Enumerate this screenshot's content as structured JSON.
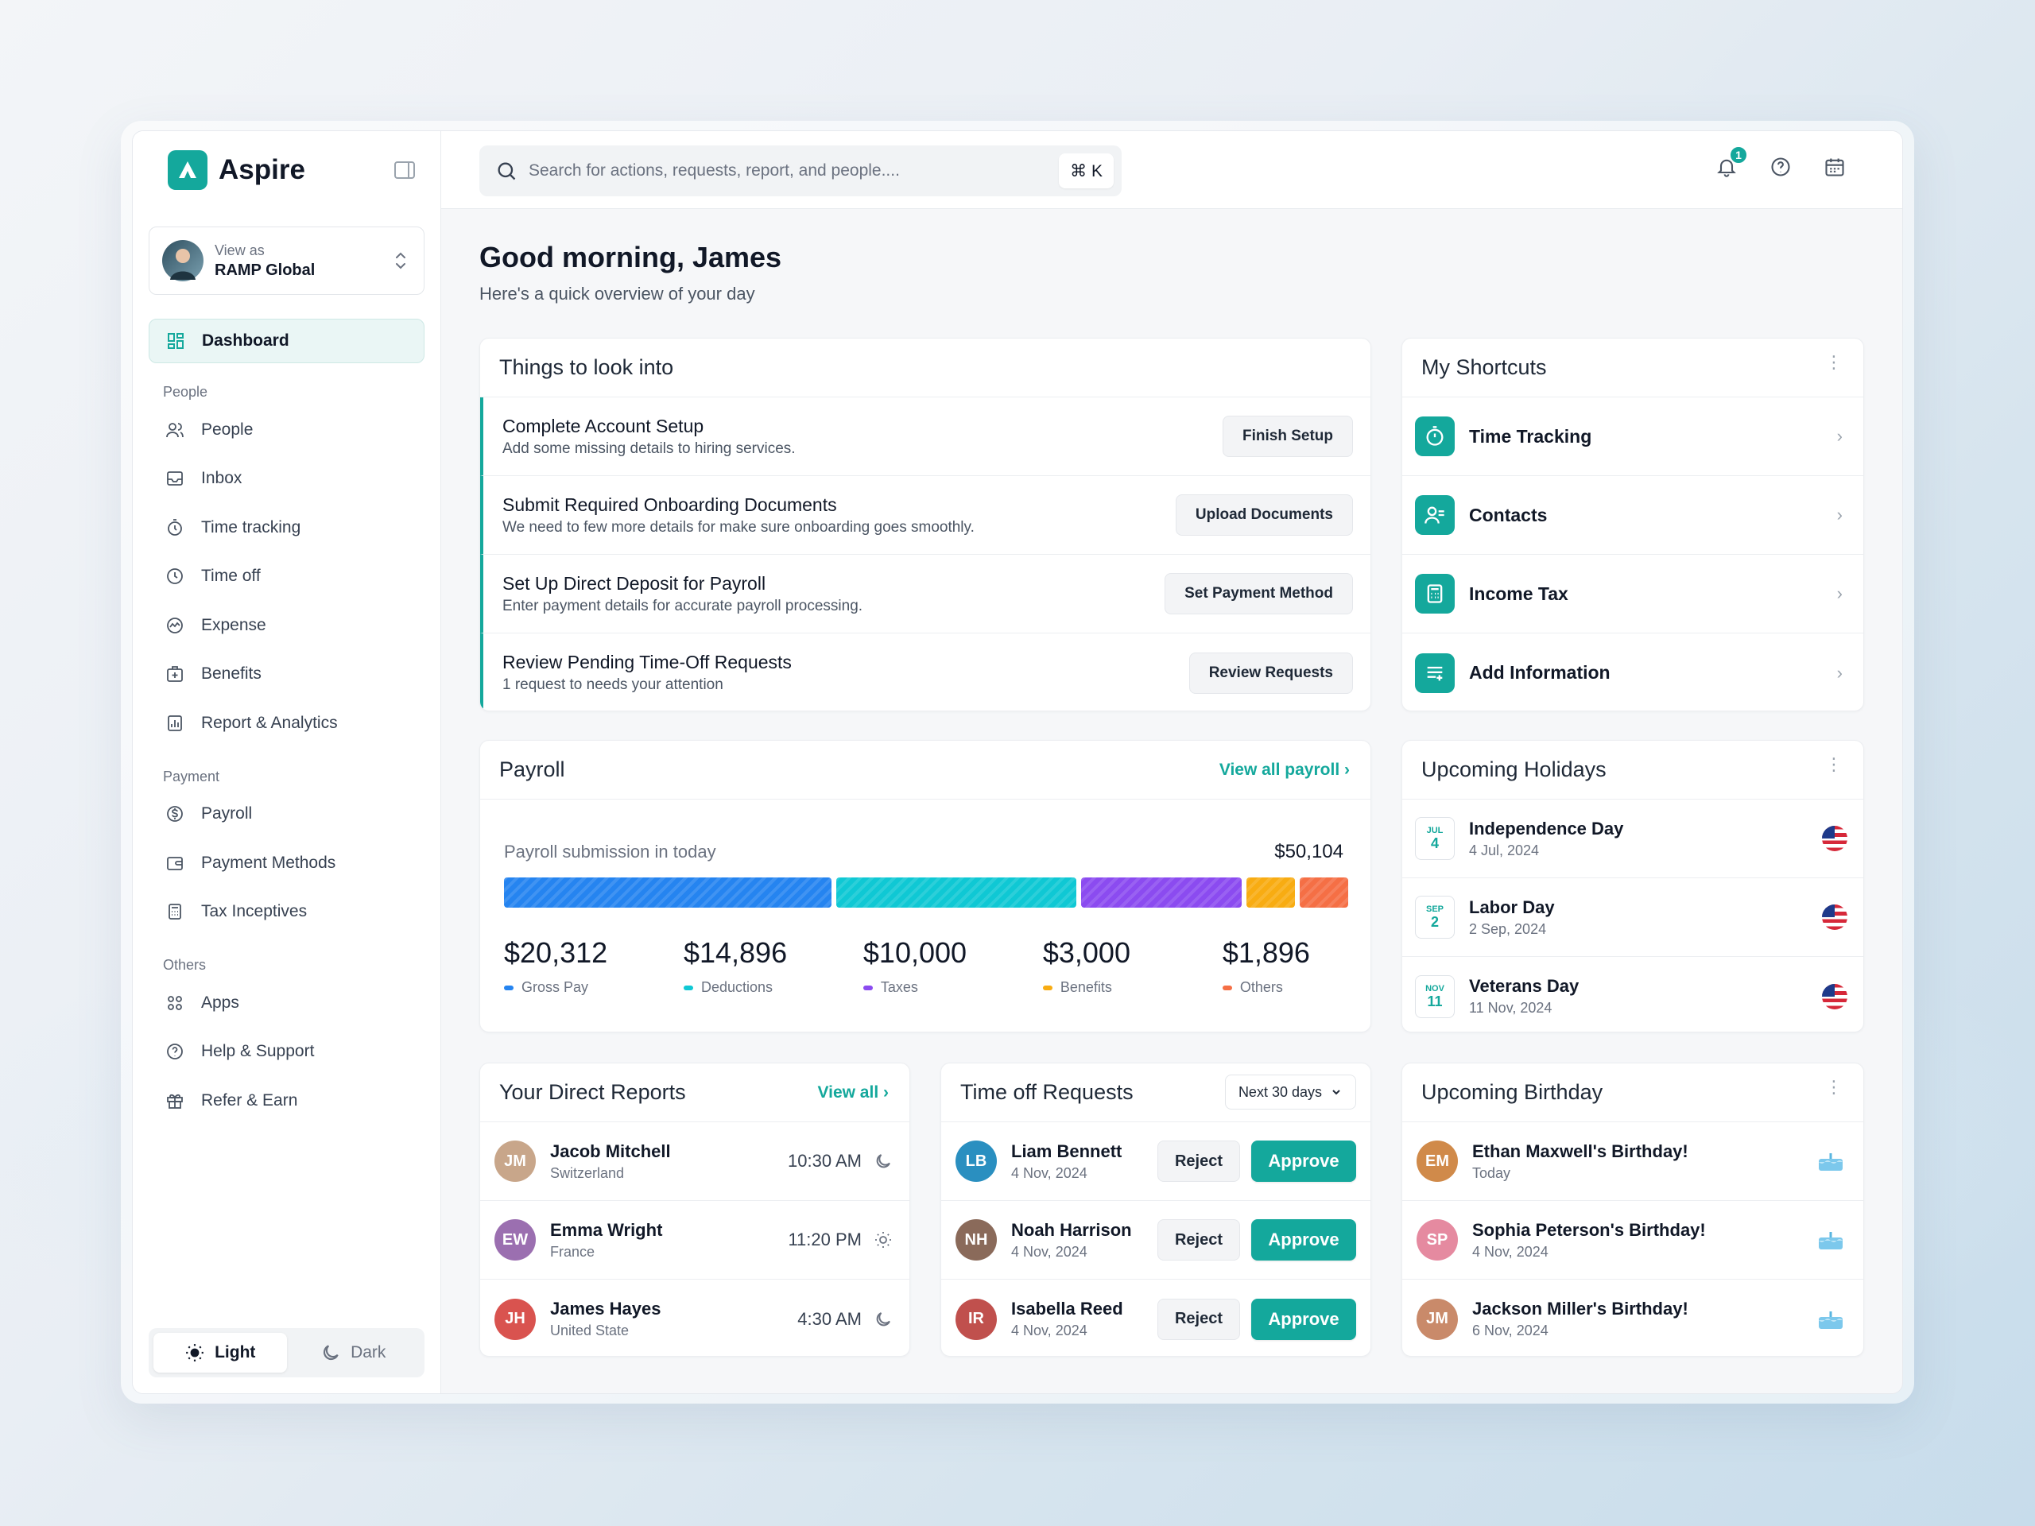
{
  "brand": {
    "name": "Aspire"
  },
  "view_as": {
    "label": "View as",
    "org": "RAMP Global"
  },
  "nav": {
    "dashboard": "Dashboard",
    "sections": [
      {
        "title": "People",
        "items": [
          "People",
          "Inbox",
          "Time tracking",
          "Time off",
          "Expense",
          "Benefits",
          "Report & Analytics"
        ]
      },
      {
        "title": "Payment",
        "items": [
          "Payroll",
          "Payment Methods",
          "Tax Inceptives"
        ]
      },
      {
        "title": "Others",
        "items": [
          "Apps",
          "Help & Support",
          "Refer & Earn"
        ]
      }
    ]
  },
  "theme": {
    "light": "Light",
    "dark": "Dark"
  },
  "search": {
    "placeholder": "Search for actions, requests, report, and people....",
    "shortcut": "⌘ K"
  },
  "notifications": {
    "count": "1"
  },
  "greeting": {
    "title": "Good morning, James",
    "subtitle": "Here's a quick overview of your day"
  },
  "things": {
    "title": "Things to look into",
    "tasks": [
      {
        "title": "Complete Account Setup",
        "desc": "Add some missing details to hiring services.",
        "action": "Finish Setup"
      },
      {
        "title": "Submit Required Onboarding Documents",
        "desc": "We need to few more details for make sure onboarding goes smoothly.",
        "action": "Upload Documents"
      },
      {
        "title": "Set Up Direct Deposit for Payroll",
        "desc": "Enter payment details for accurate payroll processing.",
        "action": "Set Payment Method"
      },
      {
        "title": "Review Pending Time-Off Requests",
        "desc": "1 request to needs your attention",
        "action": "Review Requests"
      }
    ]
  },
  "shortcuts": {
    "title": "My Shortcuts",
    "items": [
      "Time Tracking",
      "Contacts",
      "Income Tax",
      "Add Information"
    ]
  },
  "payroll": {
    "title": "Payroll",
    "link": "View all payroll",
    "subtitle": "Payroll submission in today",
    "total": "$50,104",
    "breakdown": [
      {
        "value": "$20,312",
        "amount": 20312,
        "label": "Gross Pay",
        "color": "#2584f0"
      },
      {
        "value": "$14,896",
        "amount": 14896,
        "label": "Deductions",
        "color": "#0fc8d4"
      },
      {
        "value": "$10,000",
        "amount": 10000,
        "label": "Taxes",
        "color": "#8b4bf0"
      },
      {
        "value": "$3,000",
        "amount": 3000,
        "label": "Benefits",
        "color": "#f8ac12"
      },
      {
        "value": "$1,896",
        "amount": 1896,
        "label": "Others",
        "color": "#f56f45"
      }
    ]
  },
  "holidays": {
    "title": "Upcoming Holidays",
    "items": [
      {
        "month": "JUL",
        "day": "4",
        "name": "Independence Day",
        "date": "4 Jul, 2024"
      },
      {
        "month": "SEP",
        "day": "2",
        "name": "Labor Day",
        "date": "2 Sep, 2024"
      },
      {
        "month": "NOV",
        "day": "11",
        "name": "Veterans Day",
        "date": "11 Nov, 2024"
      }
    ]
  },
  "reports": {
    "title": "Your Direct Reports",
    "link": "View all",
    "people": [
      {
        "name": "Jacob Mitchell",
        "location": "Switzerland",
        "time": "10:30 AM",
        "tod": "moon"
      },
      {
        "name": "Emma Wright",
        "location": "France",
        "time": "11:20 PM",
        "tod": "sun"
      },
      {
        "name": "James Hayes",
        "location": "United State",
        "time": "4:30 AM",
        "tod": "moon"
      }
    ]
  },
  "timeoff": {
    "title": "Time off Requests",
    "filter": "Next 30 days",
    "reject": "Reject",
    "approve": "Approve",
    "requests": [
      {
        "name": "Liam Bennett",
        "date": "4 Nov, 2024"
      },
      {
        "name": "Noah Harrison",
        "date": "4 Nov, 2024"
      },
      {
        "name": "Isabella Reed",
        "date": "4 Nov, 2024"
      }
    ]
  },
  "birthdays": {
    "title": "Upcoming Birthday",
    "items": [
      {
        "name": "Ethan Maxwell's Birthday!",
        "when": "Today"
      },
      {
        "name": "Sophia Peterson's Birthday!",
        "when": "4 Nov, 2024"
      },
      {
        "name": "Jackson Miller's Birthday!",
        "when": "6 Nov, 2024"
      }
    ]
  },
  "colors": {
    "accent": "#14a89c"
  }
}
